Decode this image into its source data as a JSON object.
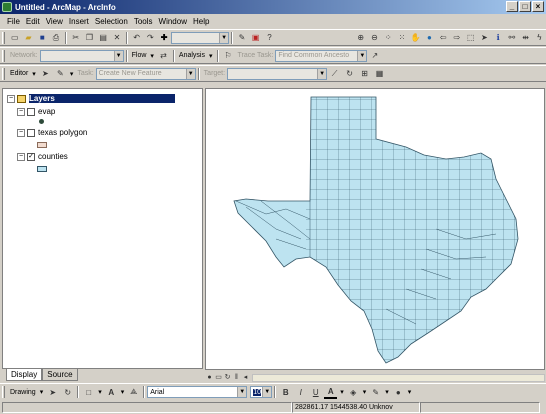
{
  "window": {
    "title": "Untitled - ArcMap - ArcInfo",
    "controls": [
      "_",
      "□",
      "×"
    ]
  },
  "menu": [
    "File",
    "Edit",
    "View",
    "Insert",
    "Selection",
    "Tools",
    "Window",
    "Help"
  ],
  "standard_toolbar": {
    "scale_value": ""
  },
  "network_toolbar": {
    "network_label": "Network:",
    "flow_label": "Flow",
    "analysis_label": "Analysis",
    "trace_task_label": "Trace Task:",
    "trace_task_value": "Find Common Ancesto"
  },
  "editor_toolbar": {
    "editor_label": "Editor",
    "task_label": "Task:",
    "task_value": "Create New Feature",
    "target_label": "Target:",
    "target_value": ""
  },
  "toc": {
    "root_label": "Layers",
    "layers": [
      {
        "name": "evap",
        "checked": false
      },
      {
        "name": "texas polygon",
        "checked": false
      },
      {
        "name": "counties",
        "checked": true
      }
    ],
    "tabs": [
      "Display",
      "Source"
    ]
  },
  "drawing_toolbar": {
    "drawing_label": "Drawing",
    "font_name": "Arial",
    "font_size": "10",
    "bold": "B",
    "italic": "I",
    "underline": "U"
  },
  "status": {
    "coordinates": "282861.17  1544538.40 Unknov"
  },
  "colors": {
    "title_bar": "#0a246a",
    "selection": "#0a246a",
    "county_fill": "#bde3f0",
    "county_outline": "#335566"
  }
}
